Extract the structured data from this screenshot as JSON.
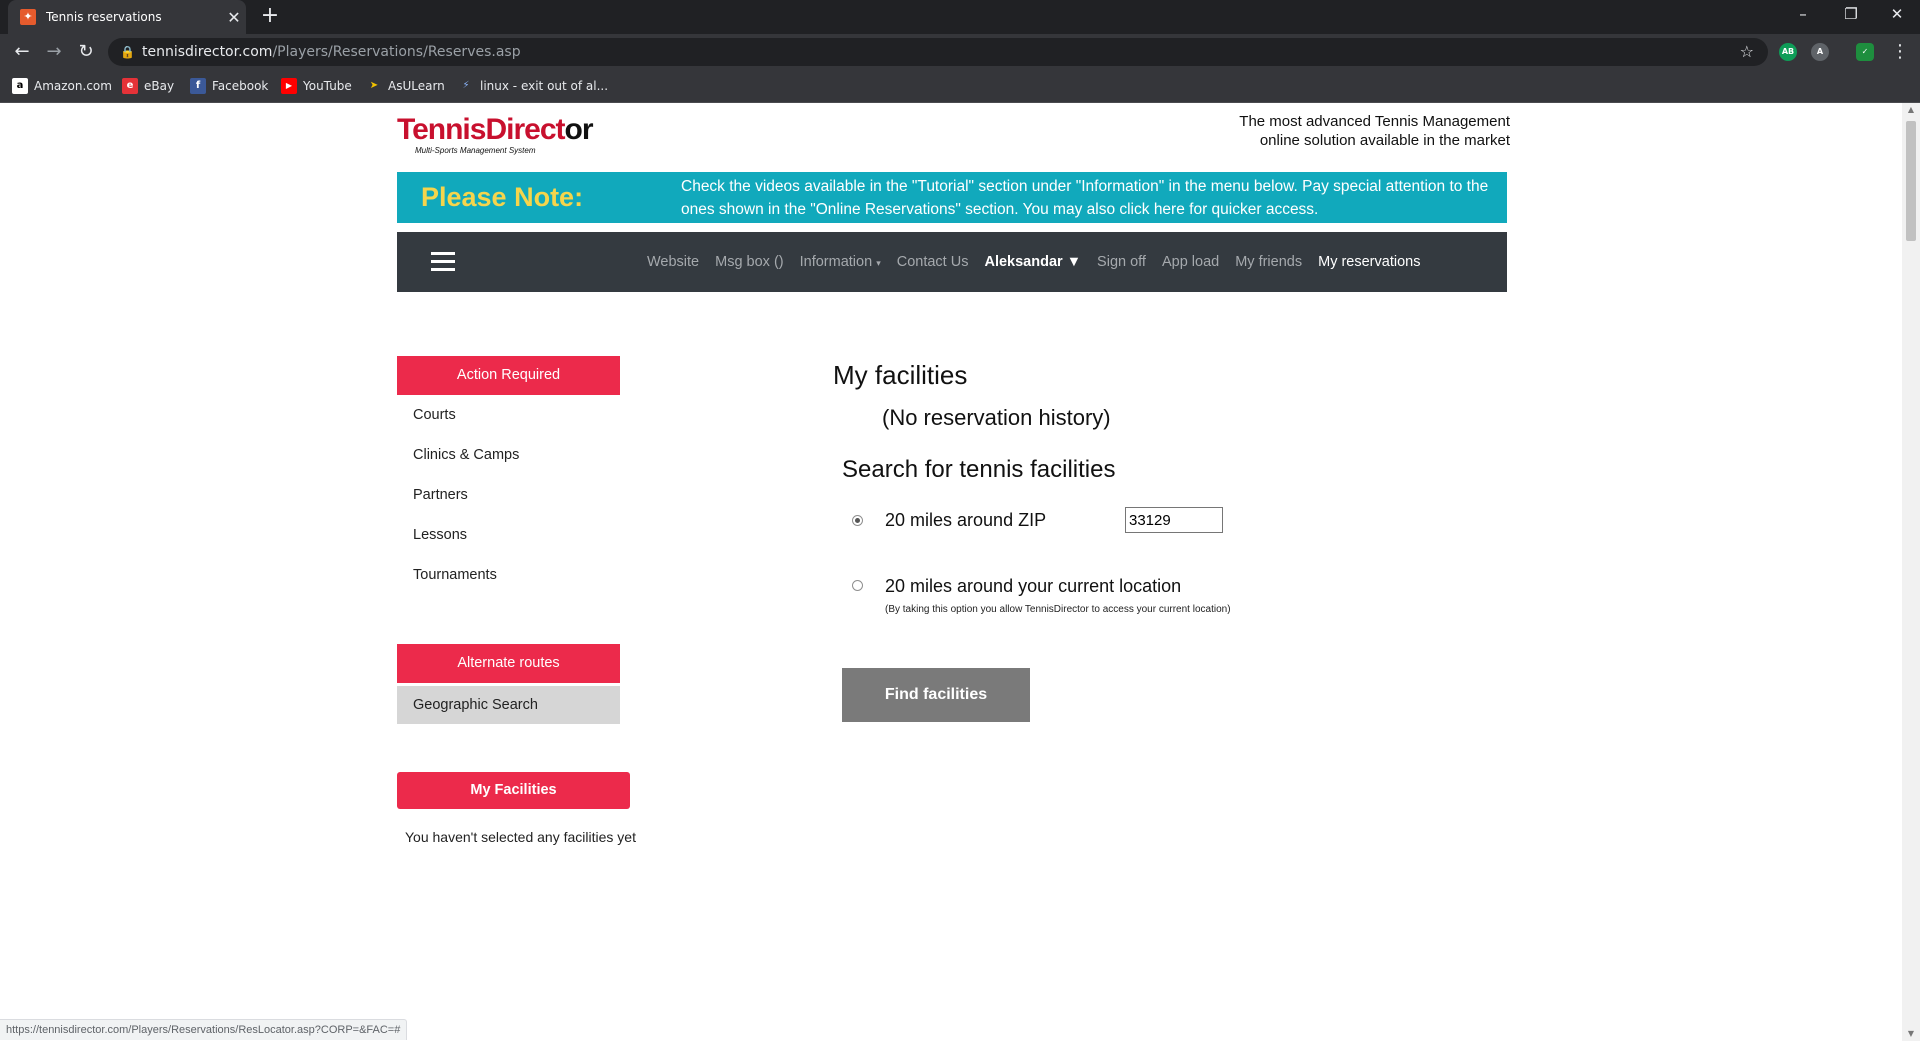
{
  "browser": {
    "tab_title": "Tennis reservations",
    "tab_close": "✕",
    "new_tab": "+",
    "url_host": "tennisdirector.com",
    "url_path": "/Players/Reservations/Reserves.asp",
    "window": {
      "minimize": "–",
      "restore": "❐",
      "close": "✕"
    },
    "extensions": [
      "AB",
      "A",
      "✓"
    ],
    "bookmarks": [
      {
        "label": "Amazon.com",
        "icon": "a"
      },
      {
        "label": "eBay",
        "icon": "e"
      },
      {
        "label": "Facebook",
        "icon": "f"
      },
      {
        "label": "YouTube",
        "icon": "▶"
      },
      {
        "label": "AsULearn",
        "icon": "➤"
      },
      {
        "label": "linux - exit out of al...",
        "icon": "⚡"
      }
    ],
    "status_url": "https://tennisdirector.com/Players/Reservations/ResLocator.asp?CORP=&FAC=#"
  },
  "header": {
    "logo_red": "TennisDirect",
    "logo_black": "or",
    "logo_sub": "Multi-Sports Management System",
    "tagline_1": "The most advanced Tennis Management",
    "tagline_2": "online solution available in the market"
  },
  "note": {
    "heading": "Please Note:",
    "text_before": "Check the videos available in the \"Tutorial\" section under \"Information\" in the menu below. Pay special attention to the ones shown in the \"Online Reservations\" section. You may also click ",
    "link": "here",
    "text_after": " for quicker access."
  },
  "nav": {
    "website": "Website",
    "msgbox": "Msg box ()",
    "information": "Information",
    "contact": "Contact Us",
    "user": "Aleksandar",
    "signoff": "Sign off",
    "appload": "App load",
    "friends": "My friends",
    "reservations": "My reservations"
  },
  "sidebar": {
    "action_required": "Action Required",
    "items": [
      "Courts",
      "Clinics & Camps",
      "Partners",
      "Lessons",
      "Tournaments"
    ],
    "alternate_routes": "Alternate routes",
    "geographic_search": "Geographic Search",
    "my_facilities": "My Facilities",
    "no_facilities": "You haven't selected any facilities yet"
  },
  "main": {
    "my_facilities_title": "My facilities",
    "no_history": "(No reservation history)",
    "search_title": "Search for tennis facilities",
    "option_zip": "20 miles around ZIP",
    "zip_value": "33129",
    "option_location": "20 miles around your current location",
    "location_note": "(By taking this option you allow TennisDirector to access your current location)",
    "find_button": "Find facilities"
  }
}
